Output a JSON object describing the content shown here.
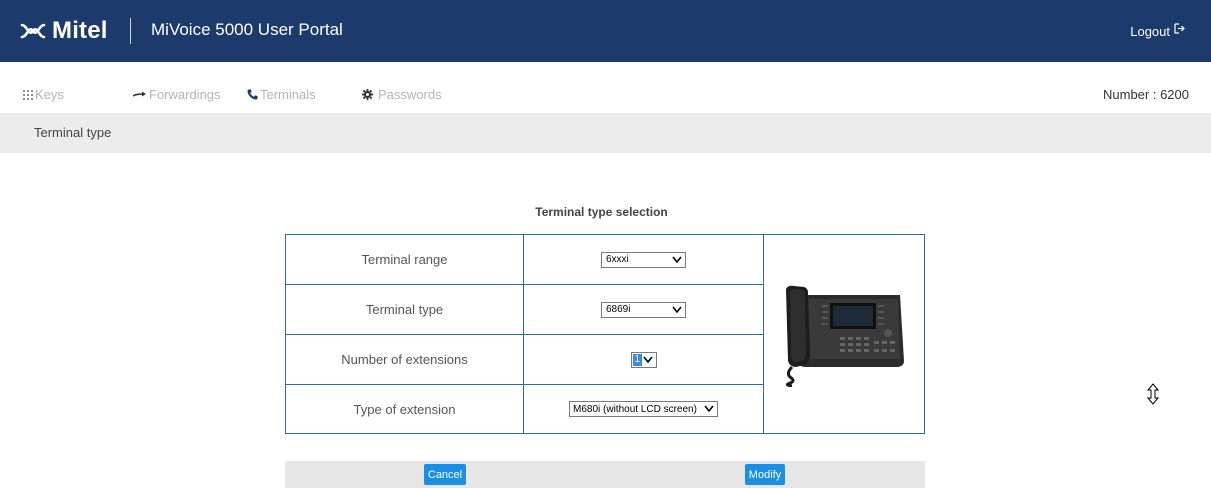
{
  "header": {
    "brand": "Mitel",
    "title": "MiVoice 5000 User Portal",
    "logout_label": "Logout"
  },
  "nav": {
    "items": [
      {
        "label": "Keys",
        "icon": "keypad-icon"
      },
      {
        "label": "Forwardings",
        "icon": "arrow-right-icon"
      },
      {
        "label": "Terminals",
        "icon": "phone-icon"
      },
      {
        "label": "Passwords",
        "icon": "gear-icon"
      }
    ],
    "number": "Number : 6200"
  },
  "breadcrumb": "Terminal type",
  "section_title": "Terminal type selection",
  "form": {
    "rows": [
      {
        "label": "Terminal range",
        "value": "6xxxi"
      },
      {
        "label": "Terminal type",
        "value": "6869i"
      },
      {
        "label": "Number of extensions",
        "value": "1"
      },
      {
        "label": "Type of extension",
        "value": "M680i (without LCD screen)"
      }
    ],
    "image": "desk-phone-image"
  },
  "buttons": {
    "cancel": "Cancel",
    "modify": "Modify"
  },
  "colors": {
    "header_bg": "#1c3a6c",
    "button_bg": "#1a8fe3",
    "table_border": "#2f6c9f"
  }
}
